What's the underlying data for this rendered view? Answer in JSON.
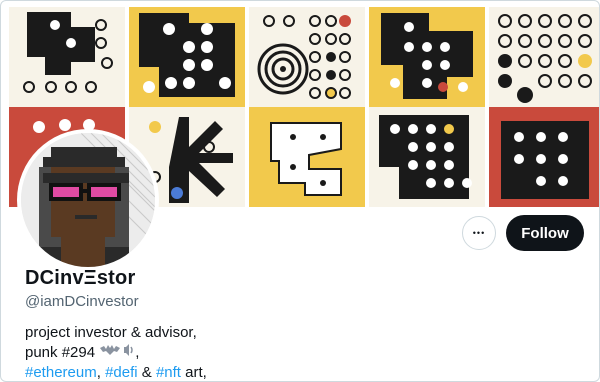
{
  "profile": {
    "name": "DCinvΞstor",
    "handle": "@iamDCinvestor",
    "bio": {
      "line1": "project investor & advisor,",
      "line2_prefix": "punk #294",
      "line2_suffix": ",",
      "tag_ethereum": "#ethereum",
      "sep1": ",",
      "tag_defi": "#defi",
      "amp": "&",
      "tag_nft": "#nft",
      "line3_suffix": "art,"
    }
  },
  "actions": {
    "more_label": "•••",
    "follow_label": "Follow"
  },
  "colors": {
    "link": "#1d9bf0",
    "follow_bg": "#0f1419",
    "tile_yellow": "#f2c94c",
    "tile_red": "#c94a3c",
    "tile_cream": "#f7f3e8"
  },
  "icons": [
    "more-icon",
    "bat-emoji-icon",
    "sound-waves-icon"
  ]
}
